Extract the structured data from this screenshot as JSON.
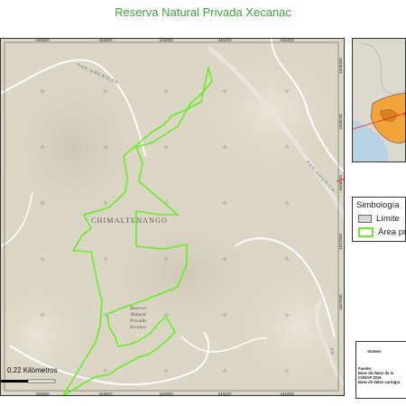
{
  "title": "Reserva Natural Privada Xecanac",
  "map": {
    "top_ticks": [
      "445600",
      "445800",
      "446000",
      "446200",
      "446400"
    ],
    "bottom_ticks": [
      "445600",
      "445800",
      "446000",
      "446200",
      "446400"
    ],
    "right_ticks": [
      "1638400",
      "1638200",
      "1638000",
      "1637800",
      "1637600"
    ],
    "place_label": "CHIMALTENANGO",
    "road_label_1": "PAN-AMERICAN",
    "road_label_2": "PAN-AMERICA",
    "road_label_3": "PA",
    "reserve_label_1": "Reserva",
    "reserve_label_2": "Natural",
    "reserve_label_3": "Privada",
    "reserve_label_4": "Xecanac",
    "scale_label": "0.22 Kilómetros",
    "colors": {
      "terrain": "#dcd6c6",
      "boundary": "#66ee22",
      "road": "#ffffff"
    }
  },
  "legend": {
    "title": "Simbología",
    "items": [
      {
        "label": "Límite",
        "color": "#d9d9d9"
      },
      {
        "label": "Área pr",
        "color": "#66ee22"
      }
    ]
  },
  "info": {
    "line1": "Sistem",
    "line2": "Fuente:",
    "line3": "Base de datos de la",
    "line4": "CONAP 2016",
    "line5": "Base de datos cartogra"
  }
}
